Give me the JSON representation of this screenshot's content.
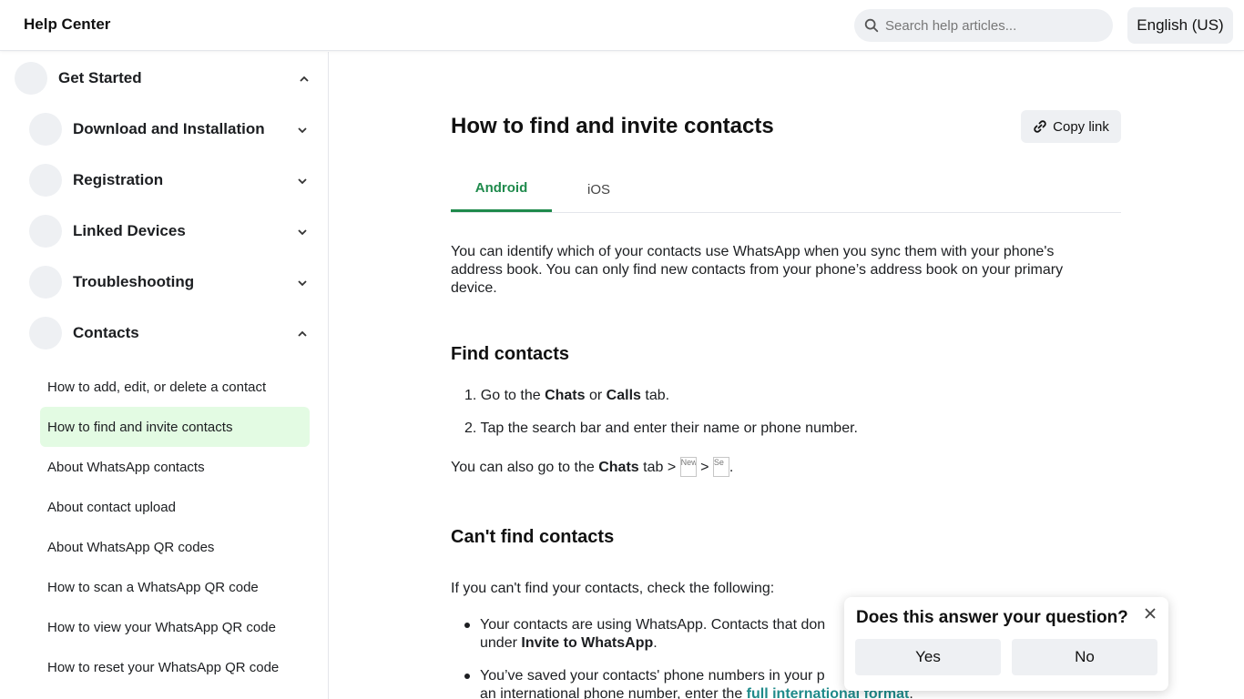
{
  "header": {
    "brand": "Help Center",
    "search_placeholder": "Search help articles...",
    "language": "English (US)"
  },
  "sidebar": {
    "top_group": {
      "label": "Get Started",
      "expanded": true
    },
    "groups": [
      {
        "label": "Download and Installation",
        "expanded": false
      },
      {
        "label": "Registration",
        "expanded": false
      },
      {
        "label": "Linked Devices",
        "expanded": false
      },
      {
        "label": "Troubleshooting",
        "expanded": false
      },
      {
        "label": "Contacts",
        "expanded": true
      }
    ],
    "contacts_items": [
      {
        "label": "How to add, edit, or delete a contact",
        "active": false
      },
      {
        "label": "How to find and invite contacts",
        "active": true
      },
      {
        "label": "About WhatsApp contacts",
        "active": false
      },
      {
        "label": "About contact upload",
        "active": false
      },
      {
        "label": "About WhatsApp QR codes",
        "active": false
      },
      {
        "label": "How to scan a WhatsApp QR code",
        "active": false
      },
      {
        "label": "How to view your WhatsApp QR code",
        "active": false
      },
      {
        "label": "How to reset your WhatsApp QR code",
        "active": false
      }
    ]
  },
  "article": {
    "title": "How to find and invite contacts",
    "copy_link": "Copy link",
    "tabs": [
      {
        "label": "Android",
        "active": true
      },
      {
        "label": "iOS",
        "active": false
      }
    ],
    "intro_line1": "You can identify which of your contacts use WhatsApp when you sync them with your phone's",
    "intro_line2": "address book. You can only find new contacts from your phone’s address book on your primary",
    "intro_line3": "device.",
    "find_heading": "Find contacts",
    "steps": {
      "s1_num": "1.",
      "s1_pre": "Go to the",
      "s1_chats": "Chats",
      "s1_or": "or",
      "s1_calls": "Calls",
      "s1_post": "tab.",
      "s2_num": "2.",
      "s2_text": "Tap the search bar and enter their name or phone number."
    },
    "also": {
      "pre": "You can also go to the",
      "chats": "Chats",
      "post": "tab >",
      "img1_alt": "New",
      "sep": ">",
      "img2_alt": "Se",
      "end": "."
    },
    "cant_heading": "Can't find contacts",
    "cant_intro": "If you can't find your contacts, check the following:",
    "bullet1_line1": "Your contacts are using WhatsApp. Contacts that don",
    "bullet1_line2_pre": "under",
    "bullet1_line2_bold": "Invite to WhatsApp",
    "bullet1_line2_post": ".",
    "bullet2_line1": "You’ve saved your contacts' phone numbers in your p",
    "bullet2_line2_pre": "an international phone number, enter the",
    "bullet2_link": "full international format",
    "bullet2_post": "."
  },
  "feedback": {
    "question": "Does this answer your question?",
    "yes": "Yes",
    "no": "No"
  },
  "colors": {
    "accent_green": "#1f8a4c",
    "active_item_bg": "#e3fbe3",
    "link_teal": "#1f8a8a"
  }
}
